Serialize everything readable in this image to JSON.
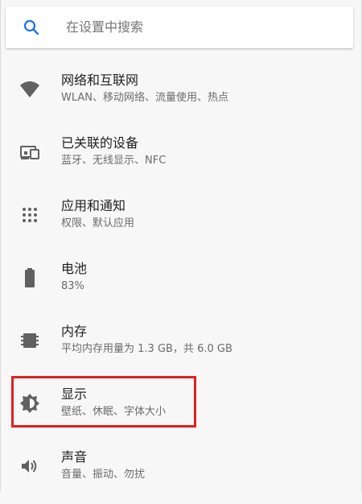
{
  "search": {
    "placeholder": "在设置中搜索",
    "icon": "search-icon"
  },
  "items": [
    {
      "title": "网络和互联网",
      "subtitle": "WLAN、移动网络、流量使用、热点",
      "icon": "wifi-icon"
    },
    {
      "title": "已关联的设备",
      "subtitle": "蓝牙、无线显示、NFC",
      "icon": "connected-devices-icon"
    },
    {
      "title": "应用和通知",
      "subtitle": "权限、默认应用",
      "icon": "apps-grid-icon"
    },
    {
      "title": "电池",
      "subtitle": "83%",
      "icon": "battery-icon"
    },
    {
      "title": "内存",
      "subtitle": "平均内存用量为 1.3 GB，共 6.0 GB",
      "icon": "memory-icon"
    },
    {
      "title": "显示",
      "subtitle": "壁纸、休眠、字体大小",
      "icon": "brightness-icon"
    },
    {
      "title": "声音",
      "subtitle": "音量、振动、勿扰",
      "icon": "volume-icon"
    }
  ],
  "colors": {
    "accent": "#1a73e8",
    "icon": "#616161",
    "highlight": "#e02020",
    "background": "#f7f7f7"
  }
}
